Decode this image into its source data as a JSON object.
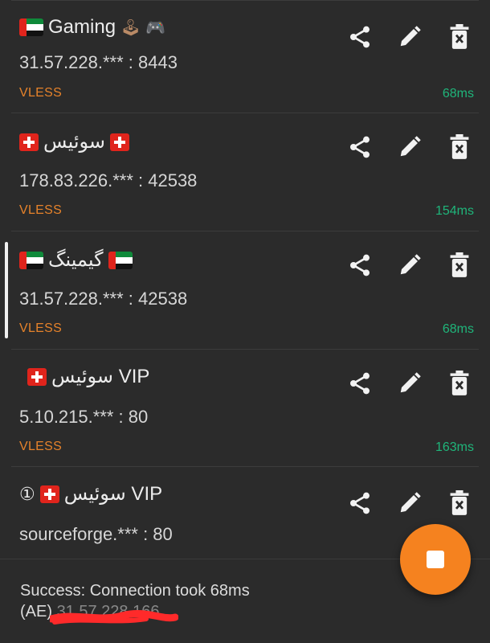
{
  "servers": [
    {
      "name_text": "Gaming",
      "name_suffix": "🕹 🎮",
      "address": "31.57.228.*** : 8443",
      "protocol": "VLESS",
      "latency": "68ms",
      "selected": false
    },
    {
      "name_text": "سوئیس",
      "address": "178.83.226.*** : 42538",
      "protocol": "VLESS",
      "latency": "154ms",
      "selected": false
    },
    {
      "name_text": "گیمینگ",
      "address": "31.57.228.*** : 42538",
      "protocol": "VLESS",
      "latency": "68ms",
      "selected": true
    },
    {
      "name_text": "سوئیس VIP",
      "address": "5.10.215.*** : 80",
      "protocol": "VLESS",
      "latency": "163ms",
      "selected": false
    },
    {
      "name_prefix": "①",
      "name_text": "سوئیس VIP",
      "address": "sourceforge.*** : 80",
      "protocol": "",
      "latency": "",
      "selected": false
    }
  ],
  "status": {
    "message": "Success: Connection took 68ms",
    "country": "(AE)",
    "ip_redacted": "31.57.228.166"
  },
  "icons": {
    "share": "share-icon",
    "edit": "pencil-icon",
    "delete": "trash-icon",
    "fab": "stop-icon"
  },
  "colors": {
    "background": "#2b2b2b",
    "protocol": "#e5822b",
    "latency": "#1fb57a",
    "fab": "#f5821f"
  }
}
